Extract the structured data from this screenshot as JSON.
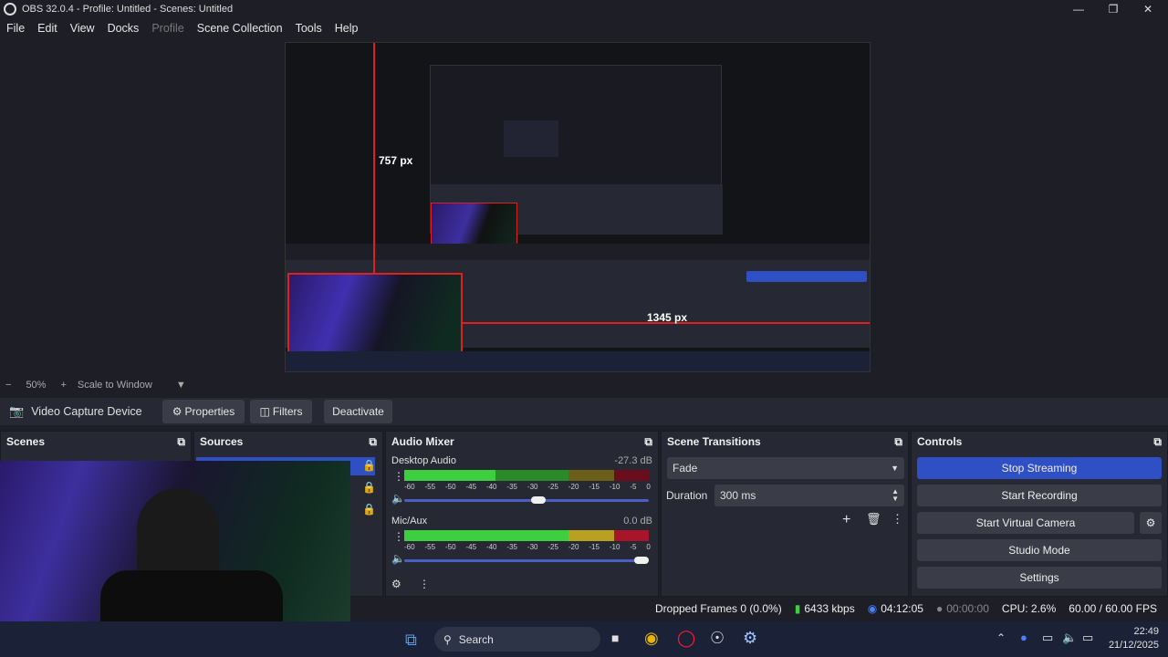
{
  "window": {
    "title": "OBS 32.0.4 - Profile: Untitled - Scenes: Untitled",
    "minimize_icon": "minimize-icon",
    "maximize_icon": "restore-icon",
    "close_icon": "close-icon"
  },
  "menu": [
    "File",
    "Edit",
    "View",
    "Docks",
    "Profile",
    "Scene Collection",
    "Tools",
    "Help"
  ],
  "zoom": {
    "minus": "−",
    "level": "50%",
    "plus": "+",
    "mode": "Scale to Window"
  },
  "preview_overlay": {
    "height_label": "757 px",
    "width_label": "1345 px"
  },
  "source_bar": {
    "source_name": "Video Capture Device",
    "properties": "Properties",
    "filters": "Filters",
    "deactivate": "Deactivate"
  },
  "scenes": {
    "title": "Scenes"
  },
  "sources": {
    "title": "Sources"
  },
  "audio_mixer": {
    "title": "Audio Mixer",
    "tracks": [
      {
        "name": "Desktop Audio",
        "db": "-27.3 dB",
        "volume": 0.55
      },
      {
        "name": "Mic/Aux",
        "db": "0.0 dB",
        "volume": 1.0
      }
    ],
    "ticks": [
      "-60",
      "-55",
      "-50",
      "-45",
      "-40",
      "-35",
      "-30",
      "-25",
      "-20",
      "-15",
      "-10",
      "-5",
      "0"
    ]
  },
  "scene_transitions": {
    "title": "Scene Transitions",
    "selected": "Fade",
    "duration_label": "Duration",
    "duration_value": "300 ms"
  },
  "controls": {
    "title": "Controls",
    "stop_streaming": "Stop Streaming",
    "start_recording": "Start Recording",
    "start_virtual_camera": "Start Virtual Camera",
    "studio_mode": "Studio Mode",
    "settings": "Settings"
  },
  "status": {
    "dropped_frames": "Dropped Frames 0 (0.0%)",
    "bitrate": "6433 kbps",
    "stream_time": "04:12:05",
    "record_time": "00:00:00",
    "cpu": "CPU: 2.6%",
    "fps": "60.00 / 60.00 FPS"
  },
  "taskbar": {
    "search": "Search",
    "time": "22:49",
    "date": "21/12/2025"
  },
  "colors": {
    "accent": "#2f4fc4",
    "panel": "#262833",
    "background": "#1e1f26",
    "meter_green": "#3ecf3e",
    "meter_yellow": "#b8a020",
    "meter_red": "#a8142a",
    "selection_red": "#e02020"
  }
}
